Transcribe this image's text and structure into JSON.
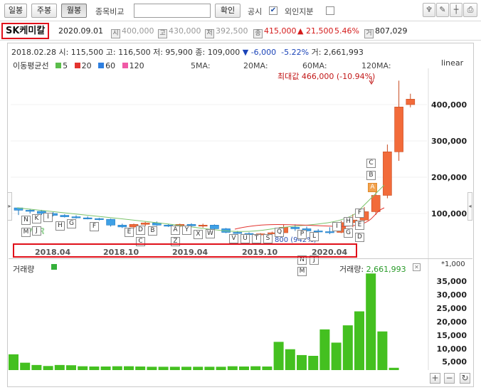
{
  "toolbar": {
    "daily_label": "일봉",
    "weekly_label": "주봉",
    "monthly_label": "월봉",
    "compare_label": "종목비교",
    "compare_value": "",
    "confirm_label": "확인",
    "disclosure_label": "공시",
    "foreign_label": "외인지분",
    "check_mark": "✔"
  },
  "info": {
    "name": "SK케미칼",
    "date": "2020.09.01",
    "open_badge": "시",
    "open": "400,000",
    "high_badge": "고",
    "high": "430,000",
    "low_badge": "저",
    "low": "392,500",
    "close_badge": "종",
    "close": "415,000",
    "change": "▲ 21,500",
    "change_pct": "5.46%",
    "volume_badge": "거",
    "volume": "807,029"
  },
  "header": {
    "text_prefix": "2018.02.28 시: 115,500 고: 116,500 저: 95,900 종: 109,000",
    "arrow": "▼",
    "change": "-6,000",
    "change_pct": "-5.22%",
    "volume_text": "거: 2,661,993"
  },
  "ma": {
    "title": "이동평균선",
    "items": [
      {
        "label": "5",
        "color": "#5bbd4b"
      },
      {
        "label": "20",
        "color": "#e3342f"
      },
      {
        "label": "60",
        "color": "#2e7fe0"
      },
      {
        "label": "120",
        "color": "#f05aa6"
      }
    ],
    "label_5": "5MA:",
    "label_20": "20MA:",
    "label_60": "60MA:",
    "label_120": "120MA:"
  },
  "scale_label": "linear",
  "max_annotation": "최대값 466,000 (-10.94%)",
  "price_axis": [
    "400,000",
    "300,000",
    "200,000",
    "100,000"
  ],
  "date_axis": [
    "2018.04",
    "2018.10",
    "2019.04",
    "2019.10",
    "2020.04"
  ],
  "low_annotation": "800 (942%)",
  "watermark": "IVER",
  "volume": {
    "title": "거래량",
    "readout_label": "거래량:",
    "readout_value": "2,661,993",
    "unit": "*1,000",
    "axis": [
      "35,000",
      "30,000",
      "25,000",
      "20,000",
      "15,000",
      "10,000",
      "5,000"
    ]
  },
  "colors": {
    "up": "#f26b3a",
    "down": "#3ea0e6",
    "volume": "#44c020",
    "highlight": "#e0101a"
  },
  "chart_data": {
    "type": "candlestick",
    "interval": "monthly",
    "y_unit": "KRW",
    "ylim": [
      0,
      470000
    ],
    "candles": [
      {
        "o": 115500,
        "h": 116500,
        "l": 95900,
        "c": 109000
      },
      {
        "o": 109000,
        "h": 113000,
        "l": 100000,
        "c": 106000
      },
      {
        "o": 106000,
        "h": 110000,
        "l": 96000,
        "c": 100000
      },
      {
        "o": 100000,
        "h": 104000,
        "l": 92000,
        "c": 95000
      },
      {
        "o": 95000,
        "h": 98000,
        "l": 89000,
        "c": 91000
      },
      {
        "o": 91000,
        "h": 95000,
        "l": 86000,
        "c": 88000
      },
      {
        "o": 88000,
        "h": 92000,
        "l": 84000,
        "c": 86000
      },
      {
        "o": 86000,
        "h": 88000,
        "l": 81000,
        "c": 84000
      },
      {
        "o": 84000,
        "h": 86000,
        "l": 64000,
        "c": 68000
      },
      {
        "o": 68000,
        "h": 72000,
        "l": 60000,
        "c": 63000
      },
      {
        "o": 63000,
        "h": 72000,
        "l": 58000,
        "c": 70000
      },
      {
        "o": 70000,
        "h": 77000,
        "l": 65000,
        "c": 74000
      },
      {
        "o": 74000,
        "h": 78000,
        "l": 66000,
        "c": 68000
      },
      {
        "o": 68000,
        "h": 71000,
        "l": 63000,
        "c": 65000
      },
      {
        "o": 65000,
        "h": 72000,
        "l": 62000,
        "c": 70000
      },
      {
        "o": 70000,
        "h": 73000,
        "l": 64000,
        "c": 66000
      },
      {
        "o": 66000,
        "h": 72000,
        "l": 61000,
        "c": 68000
      },
      {
        "o": 68000,
        "h": 70000,
        "l": 55000,
        "c": 58000
      },
      {
        "o": 58000,
        "h": 60000,
        "l": 46000,
        "c": 48000
      },
      {
        "o": 48000,
        "h": 52000,
        "l": 44000,
        "c": 45000
      },
      {
        "o": 45000,
        "h": 48000,
        "l": 40000,
        "c": 42000
      },
      {
        "o": 42000,
        "h": 46000,
        "l": 38000,
        "c": 44000
      },
      {
        "o": 44000,
        "h": 50000,
        "l": 40000,
        "c": 47000
      },
      {
        "o": 47000,
        "h": 70000,
        "l": 45000,
        "c": 62000
      },
      {
        "o": 62000,
        "h": 70000,
        "l": 52000,
        "c": 58000
      },
      {
        "o": 58000,
        "h": 64000,
        "l": 50000,
        "c": 52000
      },
      {
        "o": 52000,
        "h": 57000,
        "l": 42000,
        "c": 50000
      },
      {
        "o": 50000,
        "h": 62000,
        "l": 43000,
        "c": 48000
      },
      {
        "o": 48000,
        "h": 80000,
        "l": 46000,
        "c": 75000
      },
      {
        "o": 75000,
        "h": 98000,
        "l": 62000,
        "c": 82000
      },
      {
        "o": 82000,
        "h": 118000,
        "l": 78000,
        "c": 105000
      },
      {
        "o": 105000,
        "h": 170000,
        "l": 96000,
        "c": 150000
      },
      {
        "o": 150000,
        "h": 290000,
        "l": 142000,
        "c": 270000
      },
      {
        "o": 270000,
        "h": 466000,
        "l": 245000,
        "c": 393500
      },
      {
        "o": 400000,
        "h": 430000,
        "l": 392500,
        "c": 415000
      }
    ],
    "volume_thousands": [
      6200,
      2900,
      2000,
      1600,
      2000,
      1900,
      1500,
      1400,
      1400,
      1500,
      1500,
      1400,
      1300,
      1300,
      1300,
      1300,
      1300,
      1300,
      1300,
      1500,
      1400,
      1500,
      1400,
      11100,
      8200,
      5900,
      5600,
      16000,
      10800,
      17600,
      23100,
      38000,
      15200,
      900
    ]
  }
}
